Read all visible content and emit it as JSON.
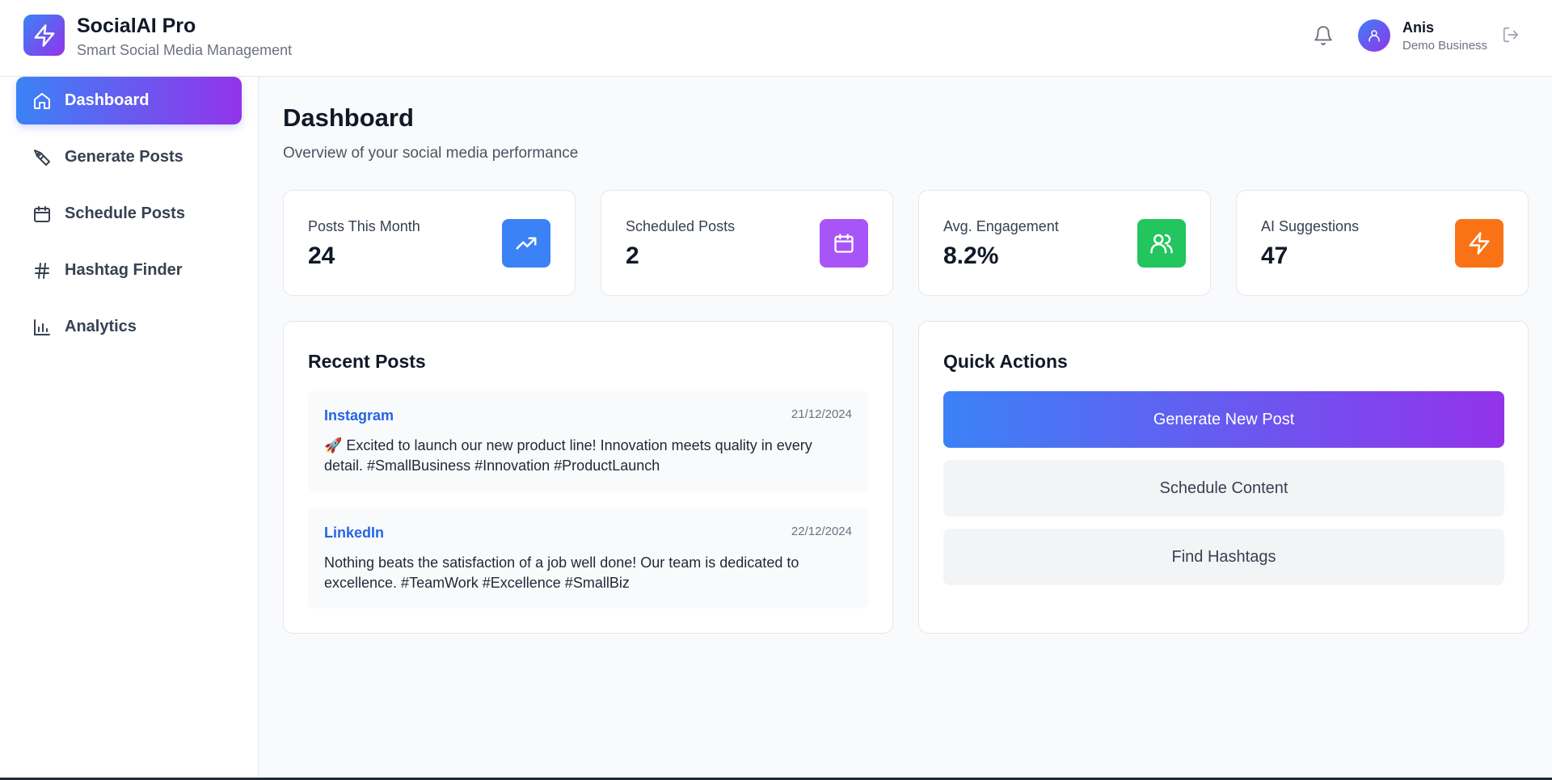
{
  "header": {
    "app_title": "SocialAI Pro",
    "app_subtitle": "Smart Social Media Management",
    "user_name": "Anis",
    "user_business": "Demo Business",
    "icons": [
      "zap-icon",
      "bell-icon",
      "user-icon",
      "logout-icon"
    ]
  },
  "sidebar": {
    "items": [
      {
        "label": "Dashboard",
        "icon": "home-icon",
        "active": true
      },
      {
        "label": "Generate Posts",
        "icon": "pen-tool-icon",
        "active": false
      },
      {
        "label": "Schedule Posts",
        "icon": "calendar-icon",
        "active": false
      },
      {
        "label": "Hashtag Finder",
        "icon": "hash-icon",
        "active": false
      },
      {
        "label": "Analytics",
        "icon": "bar-chart-icon",
        "active": false
      }
    ]
  },
  "main": {
    "title": "Dashboard",
    "subtitle": "Overview of your social media performance",
    "stats": [
      {
        "label": "Posts This Month",
        "value": "24",
        "icon": "trending-up-icon",
        "color": "#3b82f6"
      },
      {
        "label": "Scheduled Posts",
        "value": "2",
        "icon": "calendar-icon",
        "color": "#a855f7"
      },
      {
        "label": "Avg. Engagement",
        "value": "8.2%",
        "icon": "users-icon",
        "color": "#22c55e"
      },
      {
        "label": "AI Suggestions",
        "value": "47",
        "icon": "zap-icon",
        "color": "#f97316"
      }
    ],
    "recent_posts": {
      "title": "Recent Posts",
      "posts": [
        {
          "platform": "Instagram",
          "date": "21/12/2024",
          "text": "🚀 Excited to launch our new product line! Innovation meets quality in every detail. #SmallBusiness #Innovation #ProductLaunch"
        },
        {
          "platform": "LinkedIn",
          "date": "22/12/2024",
          "text": "Nothing beats the satisfaction of a job well done! Our team is dedicated to excellence. #TeamWork #Excellence #SmallBiz"
        }
      ]
    },
    "quick_actions": {
      "title": "Quick Actions",
      "buttons": [
        {
          "label": "Generate New Post"
        },
        {
          "label": "Schedule Content"
        },
        {
          "label": "Find Hashtags"
        }
      ]
    }
  }
}
